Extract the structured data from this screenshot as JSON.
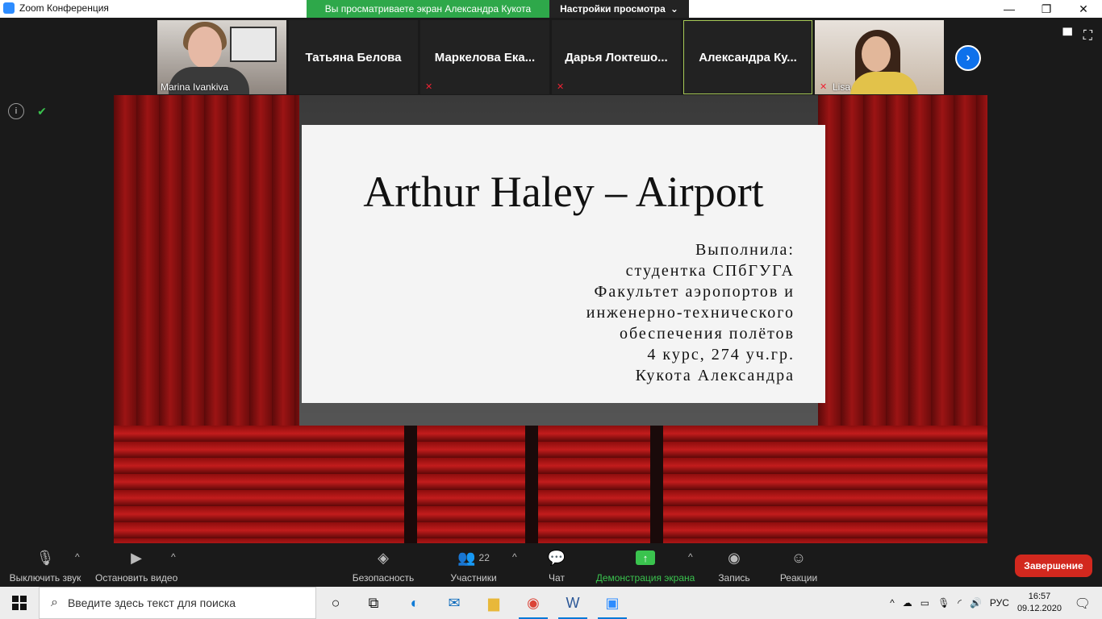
{
  "window": {
    "title": "Zoom Конференция",
    "banner": "Вы просматриваете экран Александра Кукота",
    "view_options": "Настройки просмотра"
  },
  "participants": [
    {
      "name": "Marina Ivankiva",
      "video": true
    },
    {
      "name": "Татьяна Белова",
      "video": false
    },
    {
      "name": "Маркелова Ека...",
      "video": false,
      "muted": true
    },
    {
      "name": "Дарья Локтешо...",
      "video": false,
      "muted": true
    },
    {
      "name": "Александра Ку...",
      "video": false,
      "active": true
    },
    {
      "name": "Lisa",
      "video": true,
      "muted": true
    }
  ],
  "slide": {
    "title": "Arthur Haley – Airport",
    "lines": [
      "Выполнила:",
      "студентка СПбГУГА",
      "Факультет аэропортов и",
      "инженерно-технического",
      "обеспечения полётов",
      "4 курс, 274 уч.гр.",
      "Кукота Александра"
    ]
  },
  "toolbar": {
    "mute": "Выключить звук",
    "stop_video": "Остановить видео",
    "security": "Безопасность",
    "participants": "Участники",
    "participants_count": "22",
    "chat": "Чат",
    "share": "Демонстрация экрана",
    "record": "Запись",
    "reactions": "Реакции",
    "end": "Завершение"
  },
  "taskbar": {
    "search_placeholder": "Введите здесь текст для поиска",
    "lang": "РУС",
    "time": "16:57",
    "date": "09.12.2020"
  },
  "colors": {
    "accent_green": "#3ac34e",
    "zoom_blue": "#0e71eb",
    "end_red": "#d2281e"
  }
}
